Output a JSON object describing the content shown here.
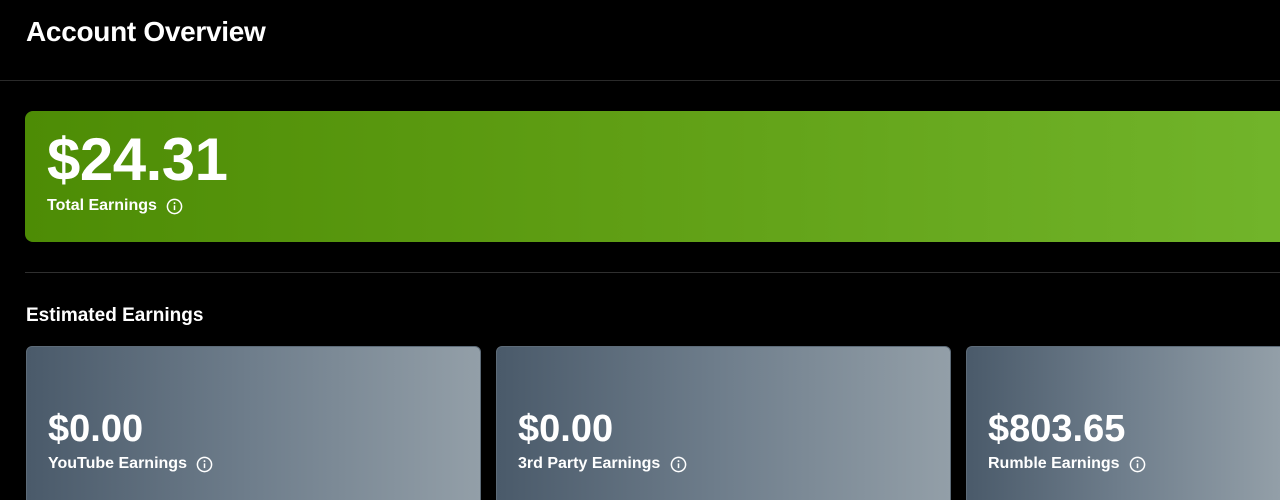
{
  "header": {
    "title": "Account Overview"
  },
  "total": {
    "amount": "$24.31",
    "label": "Total Earnings",
    "info_icon": "info-circle-icon",
    "color": "#5a9a0f"
  },
  "estimated": {
    "title": "Estimated Earnings",
    "cards": [
      {
        "amount": "$0.00",
        "label": "YouTube Earnings",
        "info_icon": "info-circle-icon"
      },
      {
        "amount": "$0.00",
        "label": "3rd Party Earnings",
        "info_icon": "info-circle-icon"
      },
      {
        "amount": "$803.65",
        "label": "Rumble Earnings",
        "info_icon": "info-circle-icon"
      }
    ]
  }
}
